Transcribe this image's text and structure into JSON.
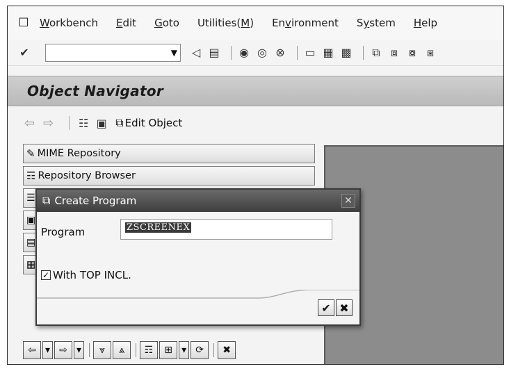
{
  "menubar": {
    "items": [
      {
        "label": "Workbench",
        "underline": "W"
      },
      {
        "label": "Edit",
        "underline": "E"
      },
      {
        "label": "Goto",
        "underline": "G"
      },
      {
        "label": "Utilities(M)",
        "underline": "M"
      },
      {
        "label": "Environment",
        "underline": "v"
      },
      {
        "label": "System",
        "underline": "y"
      },
      {
        "label": "Help",
        "underline": "H"
      }
    ]
  },
  "toolbar": {
    "command_value": ""
  },
  "page": {
    "title": "Object Navigator"
  },
  "apptoolbar": {
    "edit_object_label": "Edit Object"
  },
  "navigator": {
    "items": [
      {
        "label": "MIME Repository",
        "icon": "mime-icon"
      },
      {
        "label": "Repository Browser",
        "icon": "tree-icon"
      }
    ]
  },
  "dialog": {
    "title": "Create Program",
    "program_label": "Program",
    "program_value": "ZSCREENEX",
    "top_incl_label": "With TOP INCL.",
    "top_incl_checked": true
  },
  "colors": {
    "title_bar_bg": "#c4c4c4",
    "dialog_title_bg": "#4a4a4a",
    "right_pane_bg": "#8c8c8c"
  }
}
